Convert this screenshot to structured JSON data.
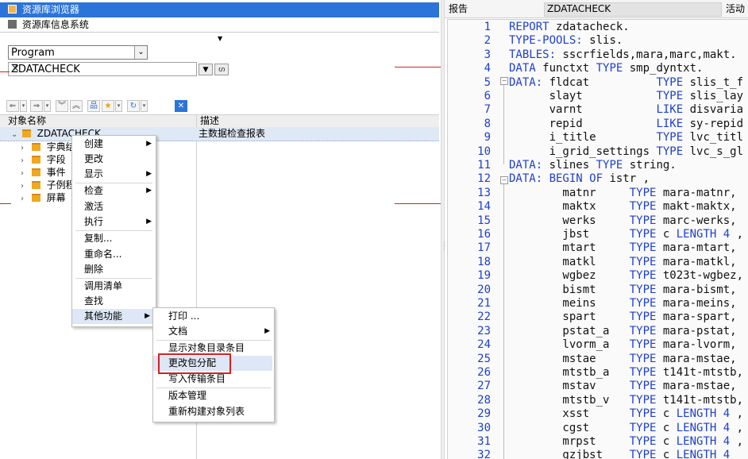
{
  "nav": {
    "browser_label": "资源库浏览器",
    "info_label": "资源库信息系统"
  },
  "selector": {
    "type_value": "Program",
    "object_value": "ZDATACHECK"
  },
  "columns": {
    "name": "对象名称",
    "desc": "描述"
  },
  "tree": {
    "root_name": "ZDATACHECK",
    "root_desc": "主数据检查报表",
    "children": [
      "字典结",
      "字段",
      "事件",
      "子例程",
      "屏幕"
    ]
  },
  "context_menu": {
    "items": [
      "创建",
      "更改",
      "显示",
      "检查",
      "激活",
      "执行",
      "复制...",
      "重命名...",
      "删除",
      "调用清单",
      "查找",
      "其他功能"
    ]
  },
  "submenu": {
    "items": [
      "打印 ...",
      "文档",
      "显示对象目录条目",
      "更改包分配",
      "写入传输条目",
      "版本管理",
      "重新构建对象列表"
    ]
  },
  "editor": {
    "label_report": "报告",
    "program_name": "ZDATACHECK",
    "status": "活动",
    "lines": [
      {
        "n": "1",
        "segs": [
          [
            "kw",
            "REPORT"
          ],
          [
            "",
            "zdatacheck."
          ]
        ]
      },
      {
        "n": "2",
        "segs": [
          [
            "kw",
            "TYPE-POOLS:"
          ],
          [
            "",
            "slis."
          ]
        ]
      },
      {
        "n": "3",
        "segs": [
          [
            "kw",
            "TABLES:"
          ],
          [
            "",
            "sscrfields,mara,marc,makt."
          ]
        ]
      },
      {
        "n": "4",
        "segs": [
          [
            "kw",
            "DATA"
          ],
          [
            "",
            "functxt "
          ],
          [
            "kw",
            "TYPE"
          ],
          [
            "",
            "smp_dyntxt."
          ]
        ]
      },
      {
        "n": "5",
        "segs": [
          [
            "kw",
            "DATA:"
          ],
          [
            "",
            "fldcat          "
          ],
          [
            "kw",
            "TYPE"
          ],
          [
            "",
            "slis_t_f"
          ]
        ]
      },
      {
        "n": "6",
        "segs": [
          [
            "",
            "      slayt           "
          ],
          [
            "kw",
            "TYPE"
          ],
          [
            "",
            "slis_lay"
          ]
        ]
      },
      {
        "n": "7",
        "segs": [
          [
            "",
            "      varnt           "
          ],
          [
            "kw",
            "LIKE"
          ],
          [
            "",
            "disvaria"
          ]
        ]
      },
      {
        "n": "8",
        "segs": [
          [
            "",
            "      repid           "
          ],
          [
            "kw",
            "LIKE"
          ],
          [
            "",
            "sy-repid"
          ]
        ]
      },
      {
        "n": "9",
        "segs": [
          [
            "",
            "      i_title         "
          ],
          [
            "kw",
            "TYPE"
          ],
          [
            "",
            "lvc_titl"
          ]
        ]
      },
      {
        "n": "10",
        "segs": [
          [
            "",
            "      i_grid_settings "
          ],
          [
            "kw",
            "TYPE"
          ],
          [
            "",
            "lvc_s_gl"
          ]
        ]
      },
      {
        "n": "11",
        "segs": [
          [
            "kw",
            "DATA:"
          ],
          [
            "",
            "slines "
          ],
          [
            "kw",
            "TYPE"
          ],
          [
            "",
            "string."
          ]
        ]
      },
      {
        "n": "12",
        "segs": [
          [
            "kw",
            "DATA:"
          ],
          [
            "kw",
            "BEGIN OF"
          ],
          [
            "",
            "istr ,"
          ]
        ]
      },
      {
        "n": "13",
        "segs": [
          [
            "",
            "        matnr     "
          ],
          [
            "kw",
            "TYPE"
          ],
          [
            "",
            "mara-matnr,"
          ]
        ]
      },
      {
        "n": "14",
        "segs": [
          [
            "",
            "        maktx     "
          ],
          [
            "kw",
            "TYPE"
          ],
          [
            "",
            "makt-maktx,"
          ]
        ]
      },
      {
        "n": "15",
        "segs": [
          [
            "",
            "        werks     "
          ],
          [
            "kw",
            "TYPE"
          ],
          [
            "",
            "marc-werks,"
          ]
        ]
      },
      {
        "n": "16",
        "segs": [
          [
            "",
            "        jbst      "
          ],
          [
            "kw",
            "TYPE"
          ],
          [
            "",
            "c "
          ],
          [
            "kw",
            "LENGTH"
          ],
          [
            "kw",
            "4"
          ],
          [
            "",
            ","
          ]
        ]
      },
      {
        "n": "17",
        "segs": [
          [
            "",
            "        mtart     "
          ],
          [
            "kw",
            "TYPE"
          ],
          [
            "",
            "mara-mtart,"
          ]
        ]
      },
      {
        "n": "18",
        "segs": [
          [
            "",
            "        matkl     "
          ],
          [
            "kw",
            "TYPE"
          ],
          [
            "",
            "mara-matkl,"
          ]
        ]
      },
      {
        "n": "19",
        "segs": [
          [
            "",
            "        wgbez     "
          ],
          [
            "kw",
            "TYPE"
          ],
          [
            "",
            "t023t-wgbez,"
          ]
        ]
      },
      {
        "n": "20",
        "segs": [
          [
            "",
            "        bismt     "
          ],
          [
            "kw",
            "TYPE"
          ],
          [
            "",
            "mara-bismt,"
          ]
        ]
      },
      {
        "n": "21",
        "segs": [
          [
            "",
            "        meins     "
          ],
          [
            "kw",
            "TYPE"
          ],
          [
            "",
            "mara-meins,"
          ]
        ]
      },
      {
        "n": "22",
        "segs": [
          [
            "",
            "        spart     "
          ],
          [
            "kw",
            "TYPE"
          ],
          [
            "",
            "mara-spart,"
          ]
        ]
      },
      {
        "n": "23",
        "segs": [
          [
            "",
            "        pstat_a   "
          ],
          [
            "kw",
            "TYPE"
          ],
          [
            "",
            "mara-pstat,"
          ]
        ]
      },
      {
        "n": "24",
        "segs": [
          [
            "",
            "        lvorm_a   "
          ],
          [
            "kw",
            "TYPE"
          ],
          [
            "",
            "mara-lvorm,"
          ]
        ]
      },
      {
        "n": "25",
        "segs": [
          [
            "",
            "        mstae     "
          ],
          [
            "kw",
            "TYPE"
          ],
          [
            "",
            "mara-mstae,"
          ]
        ]
      },
      {
        "n": "26",
        "segs": [
          [
            "",
            "        mtstb_a   "
          ],
          [
            "kw",
            "TYPE"
          ],
          [
            "",
            "t141t-mtstb,"
          ]
        ]
      },
      {
        "n": "27",
        "segs": [
          [
            "",
            "        mstav     "
          ],
          [
            "kw",
            "TYPE"
          ],
          [
            "",
            "mara-mstae,"
          ]
        ]
      },
      {
        "n": "28",
        "segs": [
          [
            "",
            "        mtstb_v   "
          ],
          [
            "kw",
            "TYPE"
          ],
          [
            "",
            "t141t-mtstb,"
          ]
        ]
      },
      {
        "n": "29",
        "segs": [
          [
            "",
            "        xsst      "
          ],
          [
            "kw",
            "TYPE"
          ],
          [
            "",
            "c "
          ],
          [
            "kw",
            "LENGTH"
          ],
          [
            "kw",
            "4"
          ],
          [
            "",
            ","
          ]
        ]
      },
      {
        "n": "30",
        "segs": [
          [
            "",
            "        cgst      "
          ],
          [
            "kw",
            "TYPE"
          ],
          [
            "",
            "c "
          ],
          [
            "kw",
            "LENGTH"
          ],
          [
            "kw",
            "4"
          ],
          [
            "",
            ","
          ]
        ]
      },
      {
        "n": "31",
        "segs": [
          [
            "",
            "        mrpst     "
          ],
          [
            "kw",
            "TYPE"
          ],
          [
            "",
            "c "
          ],
          [
            "kw",
            "LENGTH"
          ],
          [
            "kw",
            "4"
          ],
          [
            "",
            ","
          ]
        ]
      },
      {
        "n": "32",
        "segs": [
          [
            "",
            "        gzjbst    "
          ],
          [
            "kw",
            "TYPE"
          ],
          [
            "",
            "c "
          ],
          [
            "kw",
            "LENGTH"
          ],
          [
            "kw",
            "4"
          ]
        ]
      }
    ]
  },
  "colors": {
    "selection_blue": "#2c74d9",
    "keyword_blue": "#1d3fd0",
    "highlight_red": "#d62020",
    "folder_orange": "#f0a820"
  }
}
